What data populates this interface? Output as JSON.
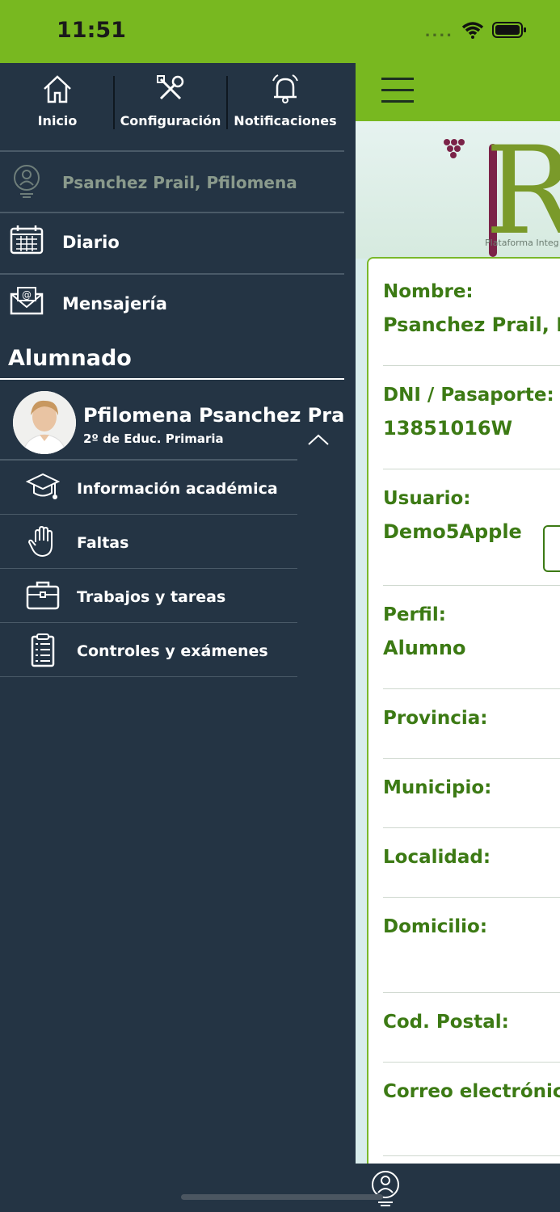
{
  "status": {
    "time": "11:51",
    "cell_dots": "....",
    "wifi_icon": "wifi-icon",
    "battery_icon": "battery-icon"
  },
  "drawer": {
    "top_actions": [
      {
        "label": "Inicio",
        "icon": "home-icon"
      },
      {
        "label": "Configuración",
        "icon": "tools-icon"
      },
      {
        "label": "Notificaciones",
        "icon": "bell-icon"
      }
    ],
    "user_name": "Psanchez Prail, Pfilomena",
    "menu": [
      {
        "label": "Diario",
        "icon": "calendar-icon"
      },
      {
        "label": "Mensajería",
        "icon": "mail-icon"
      }
    ],
    "section_title": "Alumnado",
    "student": {
      "name": "Pfilomena Psanchez Prail",
      "grade": "2º de Educ. Primaria"
    },
    "student_menu": [
      {
        "label": "Información académica",
        "icon": "graduation-cap-icon"
      },
      {
        "label": "Faltas",
        "icon": "hand-icon"
      },
      {
        "label": "Trabajos y tareas",
        "icon": "briefcase-icon"
      },
      {
        "label": "Controles y exámenes",
        "icon": "checklist-icon"
      }
    ]
  },
  "main": {
    "logo_text": "Ra",
    "logo_subtitle": "Plataforma Integ",
    "fields": [
      {
        "label": "Nombre:",
        "value": "Psanchez Prail, P"
      },
      {
        "label": "DNI / Pasaporte:",
        "value": "13851016W"
      },
      {
        "label": "Usuario:",
        "value": "Demo5Apple"
      },
      {
        "label": "Perfil:",
        "value": "Alumno"
      },
      {
        "label": "Provincia:",
        "value": ""
      },
      {
        "label": "Municipio:",
        "value": ""
      },
      {
        "label": "Localidad:",
        "value": ""
      },
      {
        "label": "Domicilio:",
        "value": ""
      },
      {
        "label": "Cod. Postal:",
        "value": ""
      },
      {
        "label": "Correo electrónico:",
        "value": ""
      }
    ]
  },
  "colors": {
    "accent_green": "#78b820",
    "drawer_bg": "#243444",
    "text_green": "#3c7a14"
  }
}
